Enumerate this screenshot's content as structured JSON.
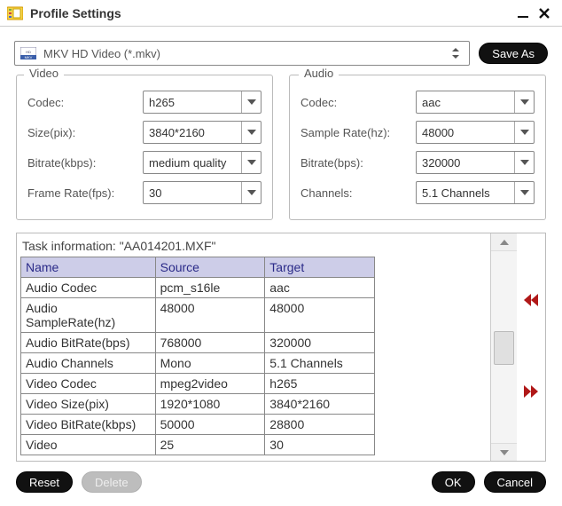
{
  "window": {
    "title": "Profile Settings"
  },
  "profile": {
    "selected": "MKV HD Video (*.mkv)",
    "saveAsLabel": "Save As"
  },
  "video": {
    "groupTitle": "Video",
    "codecLabel": "Codec:",
    "codec": "h265",
    "sizeLabel": "Size(pix):",
    "size": "3840*2160",
    "bitrateLabel": "Bitrate(kbps):",
    "bitrate": "medium quality",
    "framerateLabel": "Frame Rate(fps):",
    "framerate": "30"
  },
  "audio": {
    "groupTitle": "Audio",
    "codecLabel": "Codec:",
    "codec": "aac",
    "samplerateLabel": "Sample Rate(hz):",
    "samplerate": "48000",
    "bitrateLabel": "Bitrate(bps):",
    "bitrate": "320000",
    "channelsLabel": "Channels:",
    "channels": "5.1 Channels"
  },
  "task": {
    "title": "Task information: \"AA014201.MXF\"",
    "columns": [
      "Name",
      "Source",
      "Target"
    ],
    "rows": [
      [
        "Audio Codec",
        "pcm_s16le",
        "aac"
      ],
      [
        "Audio SampleRate(hz)",
        "48000",
        "48000"
      ],
      [
        "Audio BitRate(bps)",
        "768000",
        "320000"
      ],
      [
        "Audio Channels",
        "Mono",
        "5.1 Channels"
      ],
      [
        "Video Codec",
        "mpeg2video",
        "h265"
      ],
      [
        "Video Size(pix)",
        "1920*1080",
        "3840*2160"
      ],
      [
        "Video BitRate(kbps)",
        "50000",
        "28800"
      ],
      [
        "Video",
        "25",
        "30"
      ]
    ]
  },
  "buttons": {
    "reset": "Reset",
    "delete": "Delete",
    "ok": "OK",
    "cancel": "Cancel"
  }
}
